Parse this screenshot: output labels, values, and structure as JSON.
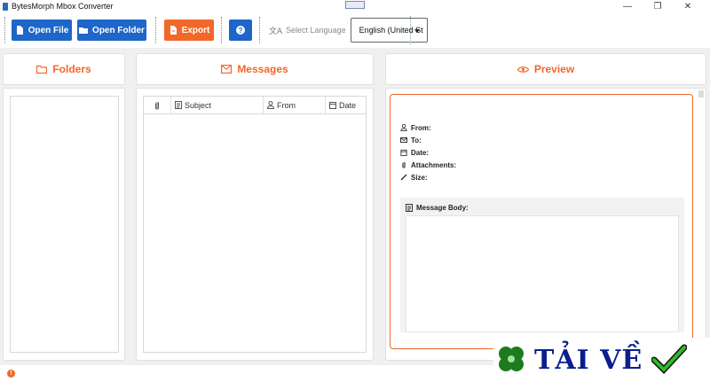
{
  "window": {
    "title": "BytesMorph Mbox Converter"
  },
  "toolbar": {
    "open_file": "Open File",
    "open_folder": "Open Folder",
    "export": "Export",
    "help": "?",
    "select_language": "Select Language",
    "language_value": "English (United St"
  },
  "panels": {
    "folders": "Folders",
    "messages": "Messages",
    "preview": "Preview"
  },
  "messages_table": {
    "columns": [
      "Subject",
      "From",
      "Date"
    ]
  },
  "preview": {
    "from": "From:",
    "to": "To:",
    "date": "Date:",
    "attachments": "Attachments:",
    "size": "Size:",
    "message_body": "Message Body:"
  },
  "status": {
    "indicator": "!"
  },
  "watermark": {
    "text": "TẢI VỀ"
  },
  "colors": {
    "accent": "#f2672a",
    "primary": "#1e66c8"
  }
}
